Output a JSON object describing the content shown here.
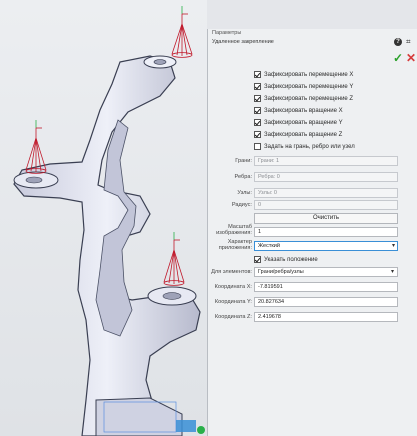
{
  "window": {
    "title": "Параметры",
    "subtitle": "Удаленное закрепление"
  },
  "toolbar": {
    "help_icon": "question-circle",
    "pin_icon": "pin",
    "ok_icon": "checkmark",
    "cancel_icon": "cross",
    "ok_color": "#2aa12a",
    "cancel_color": "#d63b3b"
  },
  "checkboxes": [
    {
      "label": "Зафиксировать перемещение X",
      "checked": true
    },
    {
      "label": "Зафиксировать перемещение Y",
      "checked": true
    },
    {
      "label": "Зафиксировать перемещение Z",
      "checked": true
    },
    {
      "label": "Зафиксировать вращение X",
      "checked": true
    },
    {
      "label": "Зафиксировать вращение Y",
      "checked": true
    },
    {
      "label": "Зафиксировать вращение Z",
      "checked": true
    },
    {
      "label": "Задать на грань, ребро или узел",
      "checked": false
    }
  ],
  "fields": {
    "faces": {
      "label": "Грани:",
      "value": "Грани: 1"
    },
    "edges": {
      "label": "Ребра:",
      "value": "Ребра: 0"
    },
    "nodes": {
      "label": "Узлы:",
      "value": "Узлы: 0"
    },
    "radius": {
      "label": "Радиус:",
      "value": "0"
    }
  },
  "clear_button": "Очистить",
  "scale": {
    "label_line1": "Масштаб",
    "label_line2": "изображения:",
    "value": "1"
  },
  "attachment": {
    "label_line1": "Характер",
    "label_line2": "приложения:",
    "value": "Жесткий"
  },
  "show_position": {
    "label": "Указать положение",
    "checked": true
  },
  "for_elements": {
    "label": "Для элементов:",
    "value": "Грани/ребра/узлы"
  },
  "coords": [
    {
      "label": "Координата X:",
      "value": "-7.819591"
    },
    {
      "label": "Координата Y:",
      "value": "20.827634"
    },
    {
      "label": "Координата Z:",
      "value": "2.419678"
    }
  ],
  "colors": {
    "constraint_red": "#c0182a",
    "part_fill": "#d9dbe8",
    "accent_blue": "#3a8fd6",
    "part_edge": "#3a3f52"
  }
}
